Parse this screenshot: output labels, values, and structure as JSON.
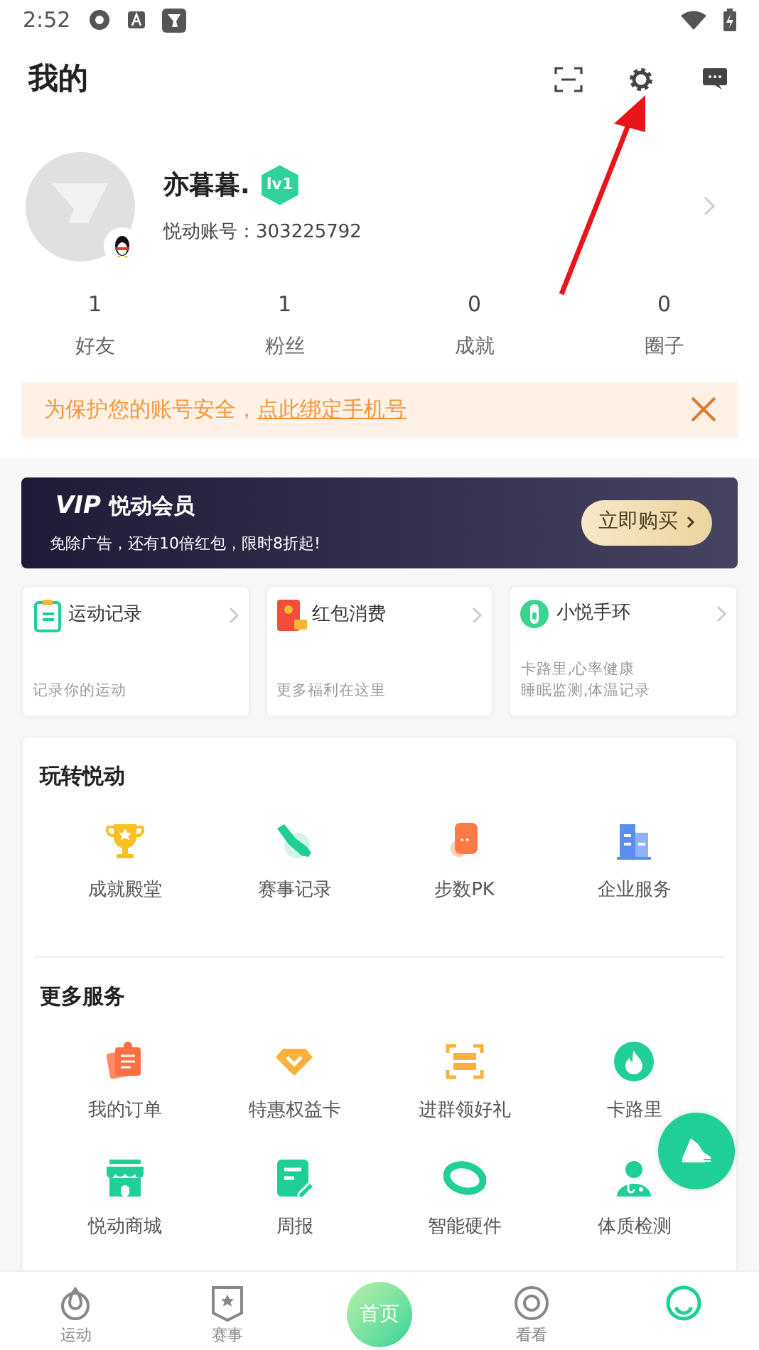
{
  "status_bar": {
    "time": "2:52"
  },
  "header": {
    "title": "我的"
  },
  "profile": {
    "name": "亦暮暮.",
    "level_badge": "lv1",
    "account": "悦动账号：303225792"
  },
  "stats": [
    {
      "value": "1",
      "label": "好友"
    },
    {
      "value": "1",
      "label": "粉丝"
    },
    {
      "value": "0",
      "label": "成就"
    },
    {
      "value": "0",
      "label": "圈子"
    }
  ],
  "notice": {
    "text": "为保护您的账号安全，",
    "link": "点此绑定手机号"
  },
  "vip": {
    "logo": "VIP",
    "title": "悦动会员",
    "subtitle": "免除广告，还有10倍红包，限时8折起!",
    "button": "立即购买"
  },
  "shortcuts": [
    {
      "kind": "record",
      "title": "运动记录",
      "lines": [
        "记录你的运动"
      ]
    },
    {
      "kind": "redpacket",
      "title": "红包消费",
      "lines": [
        "更多福利在这里"
      ]
    },
    {
      "kind": "band",
      "title": "小悦手环",
      "lines": [
        "卡路里,心率健康",
        "睡眠监测,体温记录"
      ]
    }
  ],
  "sections": [
    {
      "title": "玩转悦动",
      "items": [
        {
          "kind": "trophy",
          "label": "成就殿堂"
        },
        {
          "kind": "shoe",
          "label": "赛事记录"
        },
        {
          "kind": "pk",
          "label": "步数PK"
        },
        {
          "kind": "building",
          "label": "企业服务"
        }
      ]
    },
    {
      "title": "更多服务",
      "items": [
        {
          "kind": "order",
          "label": "我的订单"
        },
        {
          "kind": "diamond",
          "label": "特惠权益卡"
        },
        {
          "kind": "scan",
          "label": "进群领好礼"
        },
        {
          "kind": "fire",
          "label": "卡路里"
        },
        {
          "kind": "shop",
          "label": "悦动商城"
        },
        {
          "kind": "report",
          "label": "周报"
        },
        {
          "kind": "ring",
          "label": "智能硬件"
        },
        {
          "kind": "doctor",
          "label": "体质检测"
        }
      ]
    }
  ],
  "bottom_nav": [
    {
      "kind": "drop",
      "label": "运动",
      "selected": false
    },
    {
      "kind": "shield",
      "label": "赛事",
      "selected": false
    },
    {
      "kind": "home",
      "label": "首页",
      "selected": false
    },
    {
      "kind": "eye",
      "label": "看看",
      "selected": false
    },
    {
      "kind": "me",
      "selected": true
    }
  ]
}
